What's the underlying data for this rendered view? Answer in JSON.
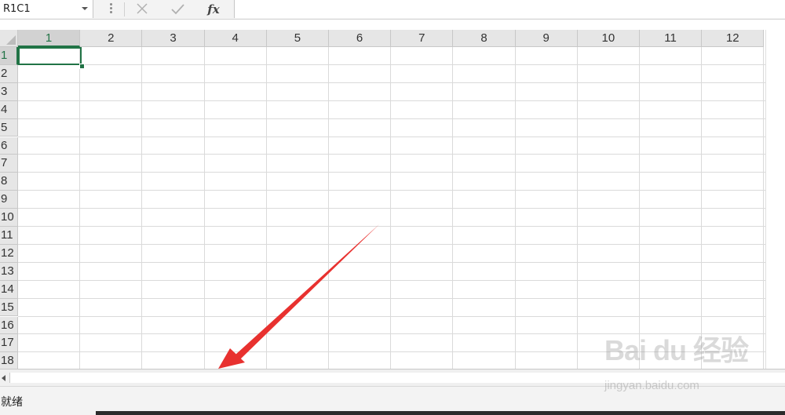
{
  "formula_bar": {
    "name_box_value": "R1C1",
    "cancel_icon": "close-icon",
    "enter_icon": "check-icon",
    "fx_label": "fx",
    "formula_value": ""
  },
  "grid": {
    "columns": [
      "1",
      "2",
      "3",
      "4",
      "5",
      "6",
      "7",
      "8",
      "9",
      "10",
      "11",
      "12"
    ],
    "rows": [
      "1",
      "2",
      "3",
      "4",
      "5",
      "6",
      "7",
      "8",
      "9",
      "10",
      "11",
      "12",
      "13",
      "14",
      "15",
      "16",
      "17",
      "18"
    ],
    "active_cell": "R1C1",
    "active_column": "1",
    "active_row": "1"
  },
  "status_bar": {
    "status_text": "就绪"
  },
  "annotation": {
    "arrow_color": "#e8312f",
    "target": "status-bar"
  },
  "watermark": {
    "logo": "Bai du 经验",
    "url": "jingyan.baidu.com"
  },
  "colors": {
    "accent": "#217346",
    "header_bg": "#e6e6e6",
    "gridline": "#dadada"
  }
}
